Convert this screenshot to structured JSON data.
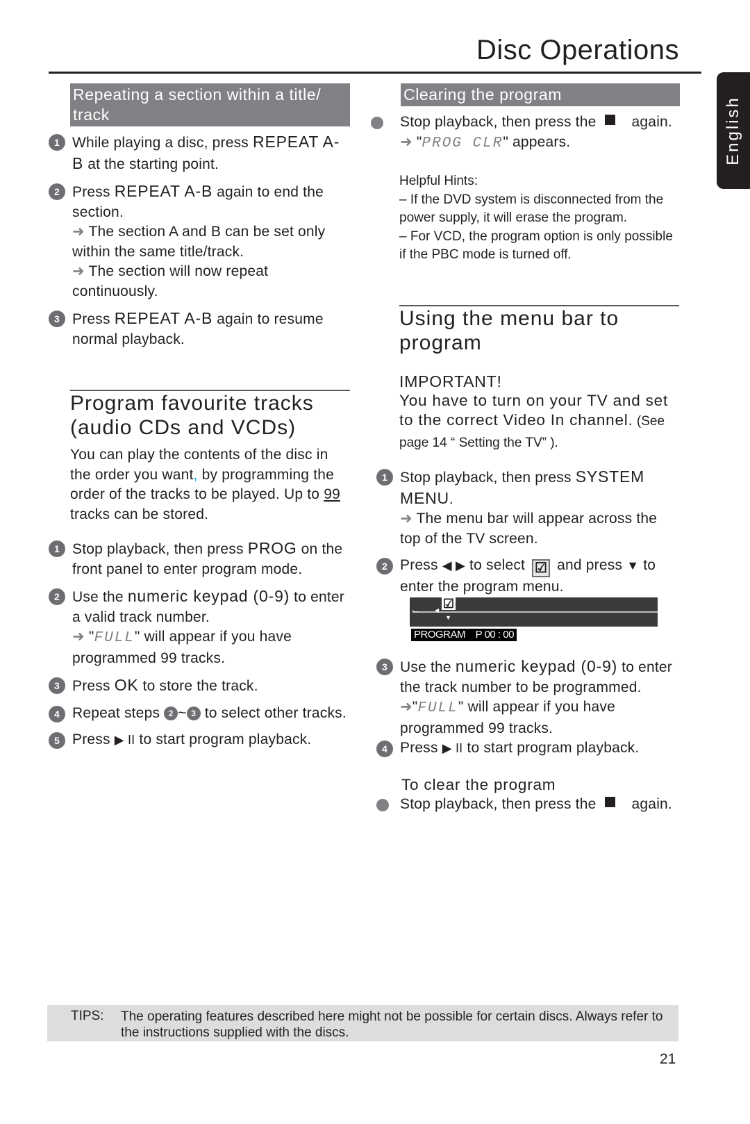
{
  "header": {
    "title": "Disc Operations",
    "language_tab": "English"
  },
  "left": {
    "repeat_section": {
      "heading": "Repeating a section within a title/ track",
      "steps": [
        {
          "num": "1",
          "text_a": "While playing a disc, press ",
          "key": "REPEAT A-B",
          "text_b": " at the starting point."
        },
        {
          "num": "2",
          "text_a": "Press ",
          "key": "REPEAT A-B",
          "text_b": " again to end the section.",
          "notes": [
            "The section A and B can be set only within the same title/track.",
            "The section will now repeat continuously."
          ]
        },
        {
          "num": "3",
          "text_a": "Press ",
          "key": "REPEAT A-B",
          "text_b": " again to resume normal playback."
        }
      ]
    },
    "program_tracks": {
      "heading": "Program favourite tracks (audio CDs and VCDs)",
      "intro_a": "You can play the contents of the disc in the order you want",
      "intro_comma": ",",
      "intro_b": " by programming the order of the tracks to be played. Up to ",
      "intro_num": "99",
      "intro_c": " tracks can be stored.",
      "steps": [
        {
          "num": "1",
          "text_a": "Stop playback, then press ",
          "key": "PROG",
          "text_b": " on the front panel to enter program mode."
        },
        {
          "num": "2",
          "text_a": "Use the ",
          "key": "numeric keypad (0-9)",
          "text_b": " to enter a valid track number.",
          "note_pre": "\"",
          "note_lcd": "FULL",
          "note_post": "\" will appear if you have programmed 99 tracks."
        },
        {
          "num": "3",
          "text_a": "Press ",
          "key": "OK",
          "text_b": " to store the track."
        },
        {
          "num": "4",
          "text_a": "Repeat steps ",
          "ref_a": "2",
          "tilde": "~",
          "ref_b": "3",
          "text_b": " to select other tracks."
        },
        {
          "num": "5",
          "text_a": "Press ",
          "key": "▶ II",
          "text_b": " to start program playback."
        }
      ]
    }
  },
  "right": {
    "clearing": {
      "heading": "Clearing the program",
      "bullet_a": "Stop playback, then press the ",
      "bullet_b": " again.",
      "note_pre": "\"",
      "note_lcd": "PROG CLR",
      "note_post": "\" appears.",
      "hints_title": "Helpful Hints:",
      "hints": [
        "– If the DVD system is disconnected from the power supply, it will erase the program.",
        "– For VCD, the program option is only possible if the PBC mode is turned off."
      ]
    },
    "menu_bar": {
      "heading": "Using the menu bar to program",
      "important_title": "IMPORTANT!",
      "important_text": "You have to turn on your TV and set to the correct Video In channel.",
      "important_ref": " (See page 14 “ Setting the TV” ).",
      "steps": [
        {
          "num": "1",
          "text_a": "Stop playback, then press ",
          "key": "SYSTEM MENU",
          "text_b": ".",
          "note": "The menu bar will appear across the top of the TV screen."
        },
        {
          "num": "2",
          "text_a": "Press ",
          "key": "◀ ▶",
          "text_mid": " to select ",
          "text_c": " and press ",
          "key2": "▼",
          "text_b": " to enter the program menu."
        },
        {
          "num": "3",
          "text_a": "Use the ",
          "key": "numeric keypad (0-9)",
          "text_b": " to enter the track number to be programmed.",
          "note_pre": "\"",
          "note_lcd": "FULL",
          "note_post": "\" will appear if you have programmed 99 tracks."
        },
        {
          "num": "4",
          "text_a": "Press ",
          "key": "▶ II",
          "text_b": " to start program playback."
        }
      ],
      "screen": {
        "label": "PROGRAM    P 00 : 00",
        "check": "☑",
        "left_arrow": "←",
        "tri_left": "◀",
        "tri_down": "▼"
      },
      "clear_subheading": "To clear the program",
      "clear_a": "Stop playback, then press the ",
      "clear_b": " again."
    }
  },
  "tips": {
    "label": "TIPS:",
    "text": "The operating features described here might not be possible for certain discs.  Always refer to the instructions supplied with the discs."
  },
  "page_number": "21",
  "icons": {
    "arrow": "➜",
    "stop": "stop-square",
    "checkbox": "☑"
  }
}
